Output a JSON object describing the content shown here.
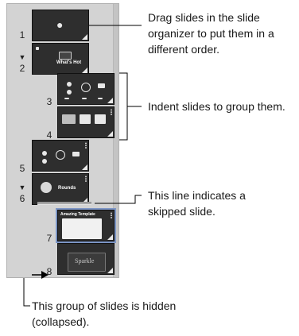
{
  "organizer": {
    "slides": [
      {
        "number": "1"
      },
      {
        "number": "2",
        "disclosure": "▼",
        "title": "What's Hot"
      },
      {
        "number": "3"
      },
      {
        "number": "4"
      },
      {
        "number": "5"
      },
      {
        "number": "6",
        "disclosure": "▼",
        "title": "Rounds"
      },
      {
        "number": "7",
        "title": "Amazing Template"
      },
      {
        "number": "8",
        "title": "Sparkle"
      }
    ]
  },
  "callouts": {
    "drag": "Drag slides in the slide organizer to put them in a different order.",
    "indent": "Indent slides to group them.",
    "skipped": "This line indicates a skipped slide.",
    "hidden": "This group of slides is hidden (collapsed)."
  },
  "colors": {
    "panel": "#d3d3d3",
    "slide_bg": "#2e2e2e",
    "selection": "#7c95c5",
    "line": "#000000"
  }
}
